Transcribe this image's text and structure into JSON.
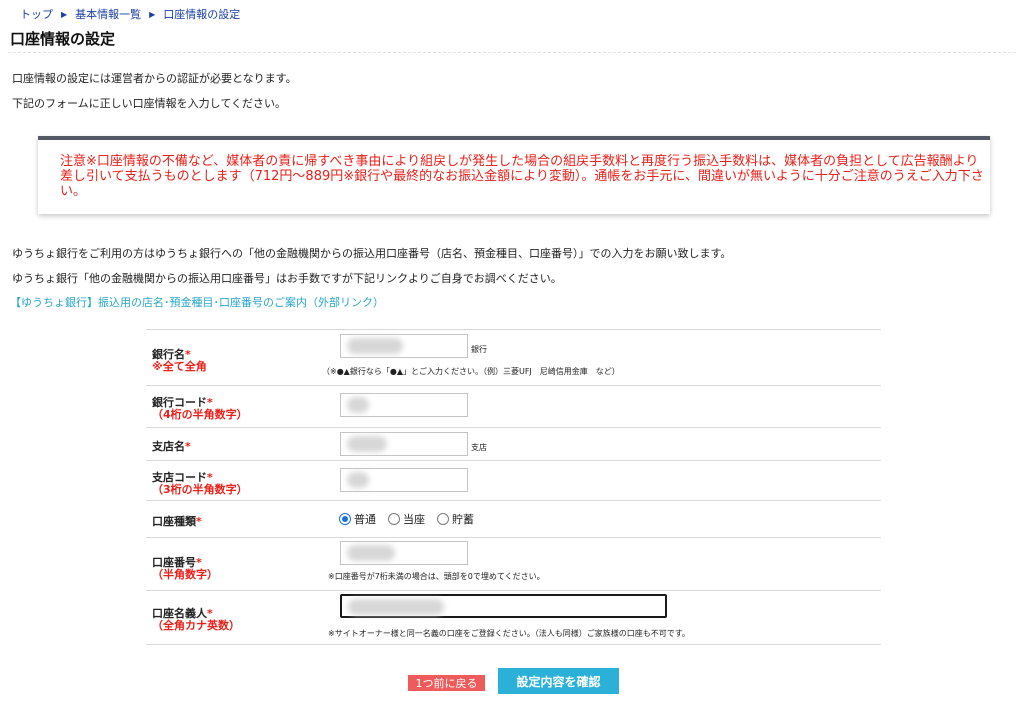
{
  "breadcrumb": {
    "items": [
      "トップ",
      "基本情報一覧",
      "口座情報の設定"
    ],
    "separator": "▶"
  },
  "page_title": "口座情報の設定",
  "intro": [
    "口座情報の設定には運営者からの認証が必要となります。",
    "下記のフォームに正しい口座情報を入力してください。"
  ],
  "notice": {
    "text": "注意※口座情報の不備など、媒体者の責に帰すべき事由により組戻しが発生した場合の組戻手数料と再度行う振込手数料は、媒体者の負担として広告報酬より差し引いて支払うものとします（712円〜889円※銀行や最終的なお振込金額により変動）。通帳をお手元に、間違いが無いように十分ご注意のうえご入力下さい。",
    "color": "#e8201a"
  },
  "info": [
    "ゆうちょ銀行をご利用の方はゆうちょ銀行への「他の金融機関からの振込用口座番号（店名、預金種目、口座番号）」での入力をお願い致します。",
    "ゆうちょ銀行「他の金融機関からの振込用口座番号」はお手数ですが下記リンクよりご自身でお調べください。"
  ],
  "external_link": "【ゆうちょ銀行】振込用の店名･預金種目･口座番号のご案内（外部リンク）",
  "form": {
    "bank_name": {
      "label": "銀行名",
      "required": "*",
      "sub": "※全て全角",
      "suffix": "銀行",
      "note": "（※●▲銀行なら「●▲」とご入力ください。（例）三菱UFJ　尼崎信用金庫　など）"
    },
    "bank_code": {
      "label": "銀行コード",
      "required": "*",
      "sub": "（4桁の半角数字）"
    },
    "branch_name": {
      "label": "支店名",
      "required": "*",
      "suffix": "支店"
    },
    "branch_code": {
      "label": "支店コード",
      "required": "*",
      "sub": "（3桁の半角数字）"
    },
    "account_type": {
      "label": "口座種類",
      "required": "*",
      "options": [
        "普通",
        "当座",
        "貯蓄"
      ],
      "selected": "普通"
    },
    "account_number": {
      "label": "口座番号",
      "required": "*",
      "sub": "（半角数字）",
      "note": "※口座番号が7桁未満の場合は、頭部を0で埋めてください。"
    },
    "account_holder": {
      "label": "口座名義人",
      "required": "*",
      "sub": "（全角カナ英数）",
      "note": "※サイトオーナー様と同一名義の口座をご登録ください。（法人も同様）ご家族様の口座も不可です。"
    }
  },
  "buttons": {
    "back": "1つ前に戻る",
    "confirm": "設定内容を確認",
    "back_color": "#ee5b5b",
    "confirm_color": "#2bb0d8"
  }
}
